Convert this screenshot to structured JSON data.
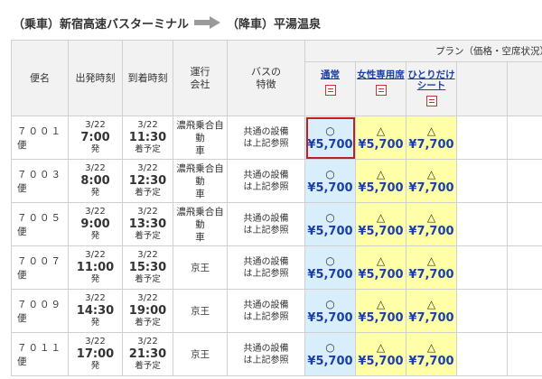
{
  "route": {
    "from": "（乗車）新宿高速バスターミナル",
    "to": "（降車）平湯温泉"
  },
  "table": {
    "headers": {
      "bus": "便名",
      "depart": "出発時刻",
      "arrive": "到着時刻",
      "operator": "運行\n会社",
      "features": "バスの\n特徴",
      "plan_group": "プラン（価格・空席状況）"
    },
    "plans": [
      {
        "label": "通常"
      },
      {
        "label": "女性専用席"
      },
      {
        "label": "ひとりだけ\nシート"
      }
    ],
    "rows": [
      {
        "bus": "７００１便",
        "date": "3/22",
        "dep": "7:00",
        "dep_suffix": "発",
        "arr": "11:30",
        "arr_suffix": "着予定",
        "operator": "濃飛乗合自動\n車",
        "features": "共通の設備\nは上記参照",
        "seats": [
          {
            "mark": "○",
            "price": "¥5,700"
          },
          {
            "mark": "△",
            "price": "¥5,700"
          },
          {
            "mark": "△",
            "price": "¥7,700"
          }
        ]
      },
      {
        "bus": "７００３便",
        "date": "3/22",
        "dep": "8:00",
        "dep_suffix": "発",
        "arr": "12:30",
        "arr_suffix": "着予定",
        "operator": "濃飛乗合自動\n車",
        "features": "共通の設備\nは上記参照",
        "seats": [
          {
            "mark": "○",
            "price": "¥5,700"
          },
          {
            "mark": "△",
            "price": "¥5,700"
          },
          {
            "mark": "△",
            "price": "¥7,700"
          }
        ]
      },
      {
        "bus": "７００５便",
        "date": "3/22",
        "dep": "9:00",
        "dep_suffix": "発",
        "arr": "13:30",
        "arr_suffix": "着予定",
        "operator": "濃飛乗合自動\n車",
        "features": "共通の設備\nは上記参照",
        "seats": [
          {
            "mark": "○",
            "price": "¥5,700"
          },
          {
            "mark": "△",
            "price": "¥5,700"
          },
          {
            "mark": "△",
            "price": "¥7,700"
          }
        ]
      },
      {
        "bus": "７００７便",
        "date": "3/22",
        "dep": "11:00",
        "dep_suffix": "発",
        "arr": "15:30",
        "arr_suffix": "着予定",
        "operator": "京王",
        "features": "共通の設備\nは上記参照",
        "seats": [
          {
            "mark": "○",
            "price": "¥5,700"
          },
          {
            "mark": "△",
            "price": "¥5,700"
          },
          {
            "mark": "△",
            "price": "¥7,700"
          }
        ]
      },
      {
        "bus": "７００９便",
        "date": "3/22",
        "dep": "14:30",
        "dep_suffix": "発",
        "arr": "19:00",
        "arr_suffix": "着予定",
        "operator": "京王",
        "features": "共通の設備\nは上記参照",
        "seats": [
          {
            "mark": "○",
            "price": "¥5,700"
          },
          {
            "mark": "△",
            "price": "¥5,700"
          },
          {
            "mark": "△",
            "price": "¥7,700"
          }
        ]
      },
      {
        "bus": "７０１１便",
        "date": "3/22",
        "dep": "17:00",
        "dep_suffix": "発",
        "arr": "21:30",
        "arr_suffix": "着予定",
        "operator": "京王",
        "features": "共通の設備\nは上記参照",
        "seats": [
          {
            "mark": "○",
            "price": "¥5,700"
          },
          {
            "mark": "△",
            "price": "¥5,700"
          },
          {
            "mark": "△",
            "price": "¥7,700"
          }
        ]
      }
    ]
  },
  "colors": {
    "available_cell": "#d9eefb",
    "few_left_cell": "#ffffa8",
    "price_text": "#1a3fa8",
    "selection_border": "#b22222"
  },
  "icons": {
    "route_arrow": "right-arrow-icon",
    "plan_badge": "seat-map-icon"
  },
  "selected": {
    "row": 0,
    "plan": 0
  }
}
